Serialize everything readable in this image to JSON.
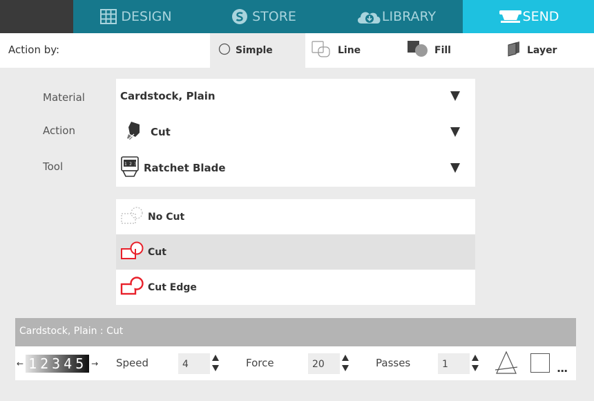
{
  "tabs": [
    {
      "label": "DESIGN",
      "icon": "grid-icon"
    },
    {
      "label": "STORE",
      "icon": "store-s-icon"
    },
    {
      "label": "LIBRARY",
      "icon": "cloud-download-icon"
    },
    {
      "label": "SEND",
      "icon": "cutter-machine-icon",
      "active": true
    }
  ],
  "action_bar": {
    "label": "Action by:",
    "options": [
      {
        "label": "Simple",
        "icon": "radio-circle-icon",
        "selected": true
      },
      {
        "label": "Line",
        "icon": "line-squares-icon"
      },
      {
        "label": "Fill",
        "icon": "fill-shapes-icon"
      },
      {
        "label": "Layer",
        "icon": "layer-pages-icon"
      }
    ]
  },
  "properties": {
    "material": {
      "label": "Material",
      "value": "Cardstock, Plain"
    },
    "action": {
      "label": "Action",
      "value": "Cut"
    },
    "tool": {
      "label": "Tool",
      "value": "Ratchet Blade"
    }
  },
  "cut_options": [
    {
      "label": "No Cut",
      "icon": "no-cut-icon"
    },
    {
      "label": "Cut",
      "icon": "cut-icon",
      "selected": true
    },
    {
      "label": "Cut Edge",
      "icon": "cut-edge-icon"
    }
  ],
  "summary": {
    "title": "Cardstock, Plain : Cut",
    "blade_digits": "12345",
    "speed": {
      "label": "Speed",
      "value": "4"
    },
    "force": {
      "label": "Force",
      "value": "20"
    },
    "passes": {
      "label": "Passes",
      "value": "1"
    },
    "more": "..."
  },
  "colors": {
    "tabbar": "#16788c",
    "tab_active": "#1ec1e0",
    "cut_red": "#e8202a"
  }
}
